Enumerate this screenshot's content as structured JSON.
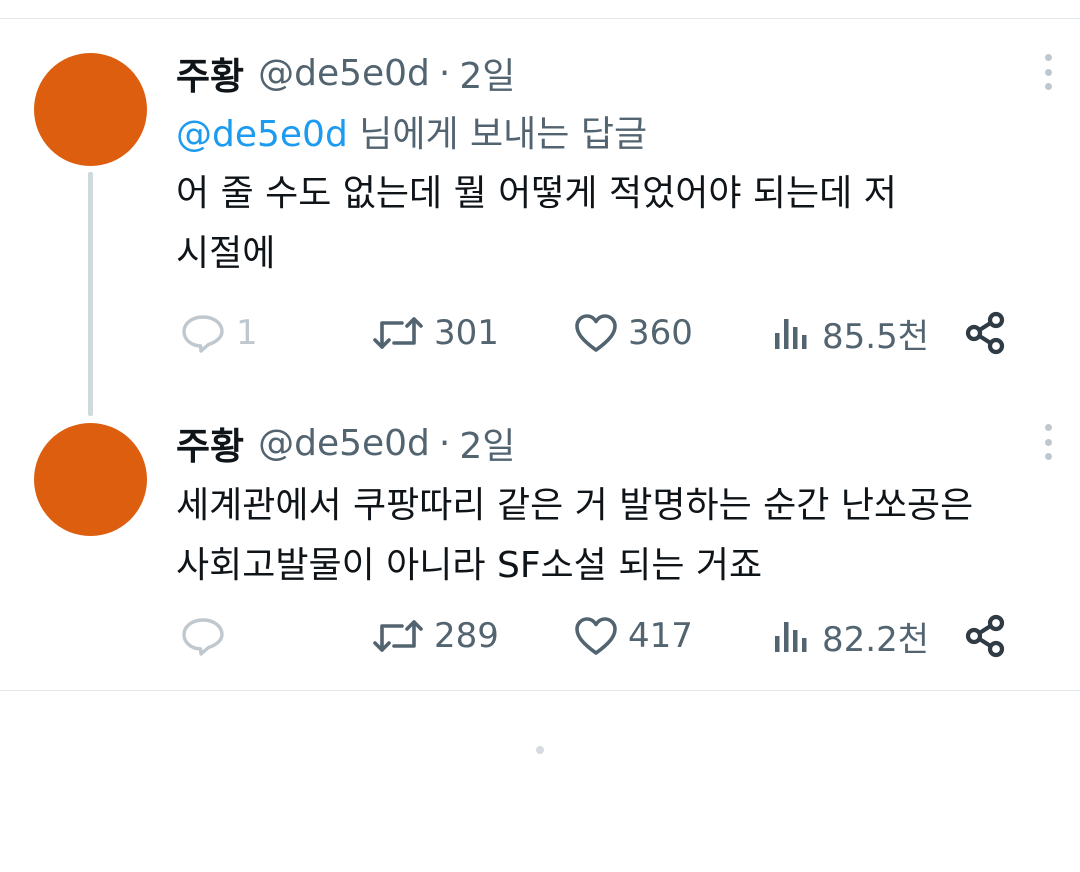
{
  "tweets": [
    {
      "author": "주황",
      "handle": "@de5e0d",
      "separator": "·",
      "time": "2일",
      "reply_mention": "@de5e0d",
      "reply_suffix": " 님에게 보내는 답글",
      "text": "어 줄 수도 없는데 뭘 어떻게 적었어야 되는데 저\n시절에",
      "avatar_color": "#de5e10",
      "stats": {
        "replies": "1",
        "retweets": "301",
        "likes": "360",
        "views": "85.5천"
      },
      "icons": {
        "reply": "reply-icon",
        "retweet": "retweet-icon",
        "like": "heart-icon",
        "views": "views-icon",
        "share": "share-icon",
        "more": "more-icon"
      }
    },
    {
      "author": "주황",
      "handle": "@de5e0d",
      "separator": "·",
      "time": "2일",
      "text": "세계관에서 쿠팡따리 같은 거 발명하는 순간 난쏘공은\n사회고발물이 아니라 SF소설 되는 거죠",
      "avatar_color": "#de5e10",
      "stats": {
        "replies": "",
        "retweets": "289",
        "likes": "417",
        "views": "82.2천"
      },
      "icons": {
        "reply": "reply-icon",
        "retweet": "retweet-icon",
        "like": "heart-icon",
        "views": "views-icon",
        "share": "share-icon",
        "more": "more-icon"
      }
    }
  ],
  "colors": {
    "text": "#0f1419",
    "secondary": "#536471",
    "link": "#1d9bf0",
    "divider": "#e6e9eb"
  }
}
